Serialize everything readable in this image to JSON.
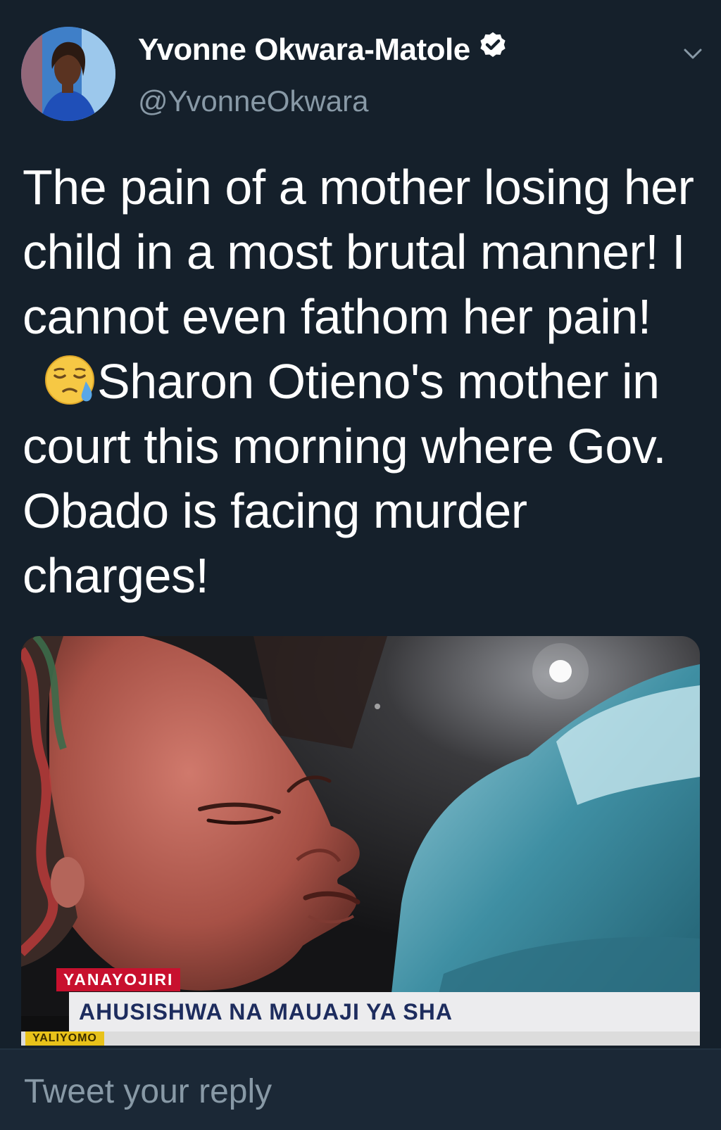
{
  "author": {
    "display_name": "Yvonne Okwara-Matole",
    "handle": "@YvonneOkwara",
    "verified": true
  },
  "tweet": {
    "text_before_emoji": "The pain of a mother losing her child in a most brutal manner! I cannot even fathom her pain!",
    "emoji": "crying-face",
    "text_after_emoji": "Sharon Otieno's mother in court this morning where Gov. Obado is facing murder charges!"
  },
  "media": {
    "ticker_label": "YANAYOJIRI",
    "ticker_headline": "AHUSISHWA NA MAUAJI YA SHA",
    "ticker_bottom_label": "YALIYOMO"
  },
  "reply": {
    "placeholder": "Tweet your reply"
  },
  "colors": {
    "background": "#15202b",
    "secondary_text": "#8899a6",
    "ticker_red": "#c8102e",
    "ticker_yellow": "#e8c21a"
  }
}
